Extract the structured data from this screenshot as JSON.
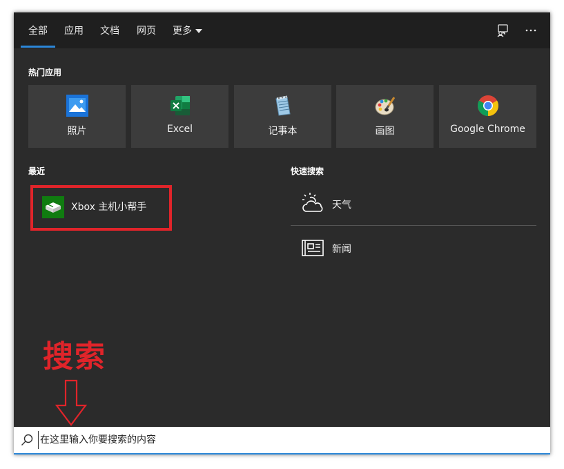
{
  "tabs": [
    {
      "label": "全部"
    },
    {
      "label": "应用"
    },
    {
      "label": "文档"
    },
    {
      "label": "网页"
    },
    {
      "label": "更多"
    }
  ],
  "top_icons": [
    "feedback-icon",
    "more-options-icon"
  ],
  "popular": {
    "title": "热门应用",
    "apps": [
      {
        "label": "照片",
        "icon": "photos-icon"
      },
      {
        "label": "Excel",
        "icon": "excel-icon"
      },
      {
        "label": "记事本",
        "icon": "notepad-icon"
      },
      {
        "label": "画图",
        "icon": "paint-icon"
      },
      {
        "label": "Google Chrome",
        "icon": "chrome-icon"
      }
    ]
  },
  "recent": {
    "title": "最近",
    "items": [
      {
        "label": "Xbox 主机小帮手",
        "icon": "xbox-companion-icon"
      }
    ]
  },
  "quick_search": {
    "title": "快速搜索",
    "items": [
      {
        "label": "天气",
        "icon": "weather-icon"
      },
      {
        "label": "新闻",
        "icon": "news-icon"
      }
    ]
  },
  "annotation": {
    "text": "搜索",
    "color": "#e0242a"
  },
  "search": {
    "placeholder": "在这里输入你要搜索的内容",
    "value": ""
  },
  "colors": {
    "accent": "#2c87d8",
    "panel": "#2b2b2b",
    "tile": "#3c3c3c",
    "highlight": "#e0242a"
  }
}
